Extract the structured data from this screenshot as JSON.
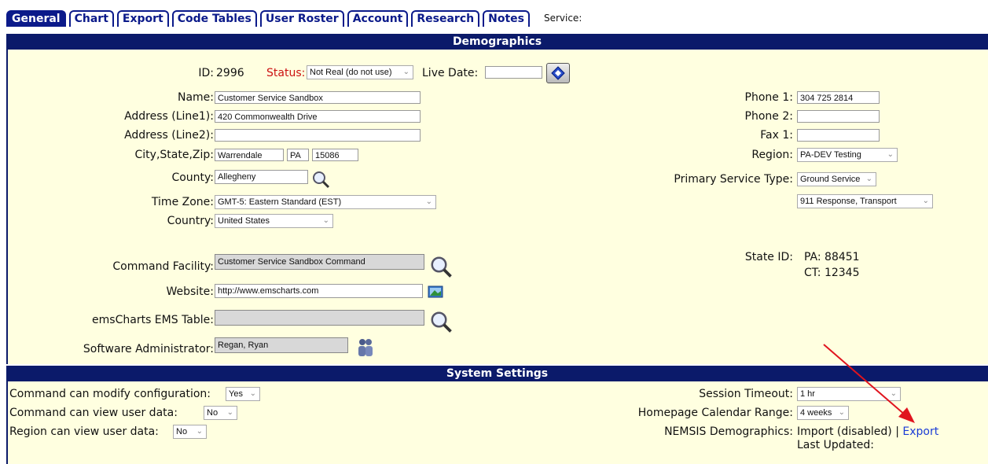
{
  "tabs": [
    "General",
    "Chart",
    "Export",
    "Code Tables",
    "User Roster",
    "Account",
    "Research",
    "Notes"
  ],
  "service_label": "Service:",
  "demographics": {
    "title": "Demographics",
    "id_label": "ID:",
    "id_value": "2996",
    "status_label": "Status:",
    "status_value": "Not Real (do not use)",
    "live_date_label": "Live Date:",
    "live_date_value": "",
    "name_label": "Name:",
    "name_value": "Customer Service Sandbox",
    "addr1_label": "Address (Line1):",
    "addr1_value": "420 Commonwealth Drive",
    "addr2_label": "Address (Line2):",
    "addr2_value": "",
    "csz_label": "City,State,Zip:",
    "city": "Warrendale",
    "state": "PA",
    "zip": "15086",
    "county_label": "County:",
    "county_value": "Allegheny",
    "tz_label": "Time Zone:",
    "tz_value": "GMT-5: Eastern Standard (EST)",
    "country_label": "Country:",
    "country_value": "United States",
    "phone1_label": "Phone 1:",
    "phone1_value": "304 725 2814",
    "phone2_label": "Phone 2:",
    "phone2_value": "",
    "fax1_label": "Fax 1:",
    "fax1_value": "",
    "region_label": "Region:",
    "region_value": "PA-DEV Testing",
    "pst_label": "Primary Service Type:",
    "pst_value": "Ground Service",
    "pst2_value": "911 Response, Transport",
    "cmd_label": "Command Facility:",
    "cmd_value": "Customer Service Sandbox Command",
    "web_label": "Website:",
    "web_value": "http://www.emscharts.com",
    "ems_label": "emsCharts EMS Table:",
    "ems_value": "",
    "admin_label": "Software Administrator:",
    "admin_value": "Regan, Ryan",
    "state_id_label": "State ID:",
    "state_id_1": "PA: 88451",
    "state_id_2": "CT: 12345"
  },
  "system": {
    "title": "System Settings",
    "cmd_modify_label": "Command can modify configuration:",
    "cmd_modify_value": "Yes",
    "cmd_view_label": "Command can view user data:",
    "cmd_view_value": "No",
    "region_view_label": "Region can view user data:",
    "region_view_value": "No",
    "session_label": "Session Timeout:",
    "session_value": "1 hr",
    "cal_label": "Homepage Calendar Range:",
    "cal_value": "4 weeks",
    "nemsis_label": "NEMSIS Demographics:",
    "nemsis_import": "Import (disabled)",
    "nemsis_sep": "|",
    "nemsis_export": "Export",
    "last_updated_label": "Last Updated:"
  },
  "colors": {
    "nav": "#0b1a6a",
    "panel": "#ffffe0",
    "status_red": "#cc1111",
    "annotation_arrow": "#e0141e",
    "link": "#1a3cd6"
  }
}
